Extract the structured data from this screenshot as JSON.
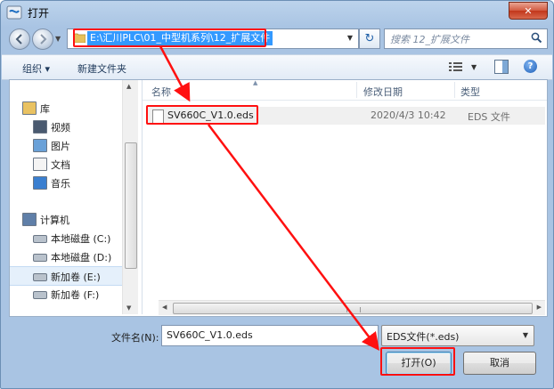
{
  "window": {
    "title": "打开",
    "close_glyph": "✕"
  },
  "address_bar": {
    "path": "E:\\汇川PLC\\01_中型机系列\\12_扩展文件",
    "refresh_glyph": "↻"
  },
  "search": {
    "placeholder": "搜索 12_扩展文件"
  },
  "toolbar": {
    "organize_label": "组织 ▾",
    "new_folder_label": "新建文件夹",
    "help_label": "?"
  },
  "nav_pane": {
    "items": [
      {
        "label": "库",
        "icon": "library-icon"
      },
      {
        "label": "视频",
        "icon": "video-icon"
      },
      {
        "label": "图片",
        "icon": "picture-icon"
      },
      {
        "label": "文档",
        "icon": "document-icon"
      },
      {
        "label": "音乐",
        "icon": "music-icon"
      },
      {
        "label": "计算机",
        "icon": "computer-icon"
      },
      {
        "label": "本地磁盘 (C:)",
        "icon": "drive-icon"
      },
      {
        "label": "本地磁盘 (D:)",
        "icon": "drive-icon"
      },
      {
        "label": "新加卷 (E:)",
        "icon": "drive-icon",
        "selected": true
      },
      {
        "label": "新加卷 (F:)",
        "icon": "drive-icon"
      }
    ]
  },
  "file_list": {
    "columns": [
      "名称",
      "修改日期",
      "类型"
    ],
    "rows": [
      {
        "name": "SV660C_V1.0.eds",
        "modified": "2020/4/3 10:42",
        "type": "EDS 文件"
      }
    ]
  },
  "bottom": {
    "filename_label": "文件名(N):",
    "filename_value": "SV660C_V1.0.eds",
    "filter_value": "EDS文件(*.eds)",
    "open_label": "打开(O)",
    "cancel_label": "取消"
  },
  "colors": {
    "annotation_red": "#ff1010",
    "selection_blue": "#3399ff"
  }
}
